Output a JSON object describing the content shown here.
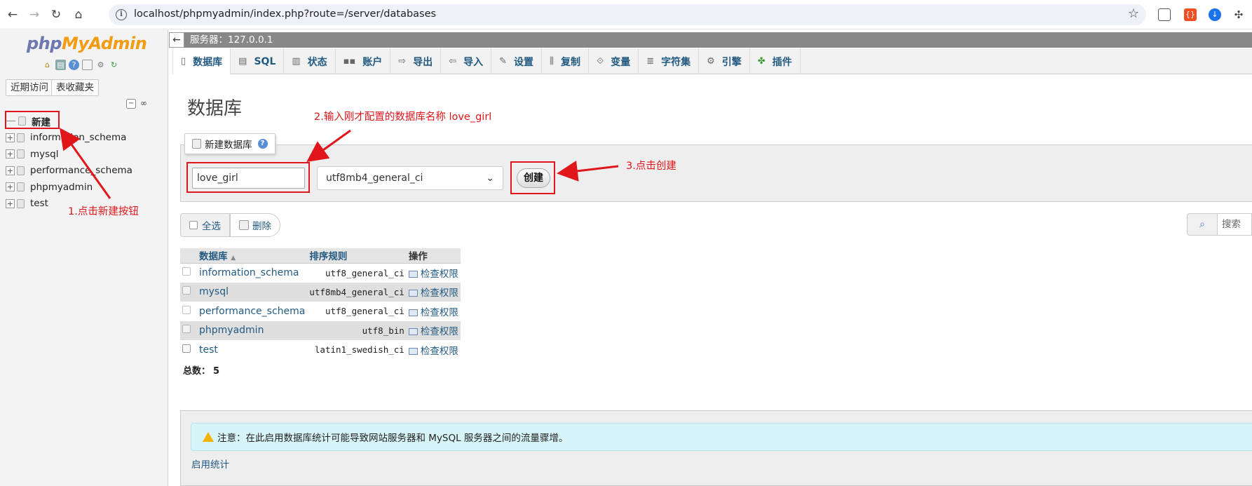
{
  "browser": {
    "url": "localhost/phpmyadmin/index.php?route=/server/databases"
  },
  "nav": {
    "logo_php": "php",
    "logo_my": "MyAdmin",
    "tab_recent": "近期访问",
    "tab_favorites": "表收藏夹",
    "tree": [
      {
        "label": "新建",
        "type": "new"
      },
      {
        "label": "information_schema"
      },
      {
        "label": "mysql"
      },
      {
        "label": "performance_schema"
      },
      {
        "label": "phpmyadmin"
      },
      {
        "label": "test"
      }
    ]
  },
  "server_bar": {
    "label": "服务器：127.0.0.1"
  },
  "tabs": [
    {
      "label": "数据库",
      "icon": "database-icon",
      "active": true
    },
    {
      "label": "SQL",
      "icon": "sql-icon"
    },
    {
      "label": "状态",
      "icon": "status-icon"
    },
    {
      "label": "账户",
      "icon": "accounts-icon"
    },
    {
      "label": "导出",
      "icon": "export-icon"
    },
    {
      "label": "导入",
      "icon": "import-icon"
    },
    {
      "label": "设置",
      "icon": "settings-icon"
    },
    {
      "label": "复制",
      "icon": "replication-icon"
    },
    {
      "label": "变量",
      "icon": "variables-icon"
    },
    {
      "label": "字符集",
      "icon": "charsets-icon"
    },
    {
      "label": "引擎",
      "icon": "engines-icon"
    },
    {
      "label": "插件",
      "icon": "plugins-icon"
    }
  ],
  "page_title": "数据库",
  "create": {
    "legend": "新建数据库",
    "db_name_value": "love_girl",
    "collation": "utf8mb4_general_ci",
    "button": "创建"
  },
  "annotations": {
    "step1": "1.点击新建按钮",
    "step2": "2.输入刚才配置的数据库名称 love_girl",
    "step3": "3.点击创建"
  },
  "list": {
    "select_all": "全选",
    "delete": "删除",
    "search_placeholder": "搜索",
    "headers": {
      "database": "数据库",
      "collation": "排序规则",
      "action": "操作"
    },
    "rows": [
      {
        "name": "information_schema",
        "collation": "utf8_general_ci",
        "action": "检查权限"
      },
      {
        "name": "mysql",
        "collation": "utf8mb4_general_ci",
        "action": "检查权限"
      },
      {
        "name": "performance_schema",
        "collation": "utf8_general_ci",
        "action": "检查权限"
      },
      {
        "name": "phpmyadmin",
        "collation": "utf8_bin",
        "action": "检查权限"
      },
      {
        "name": "test",
        "collation": "latin1_swedish_ci",
        "action": "检查权限"
      }
    ],
    "total_label": "总数：",
    "total_value": "5"
  },
  "notice": {
    "text": "注意：在此启用数据库统计可能导致网站服务器和 MySQL 服务器之间的流量骤增。",
    "enable_link": "启用统计"
  },
  "colors": {
    "accent_red": "#e0161b",
    "link_blue": "#235a81"
  }
}
